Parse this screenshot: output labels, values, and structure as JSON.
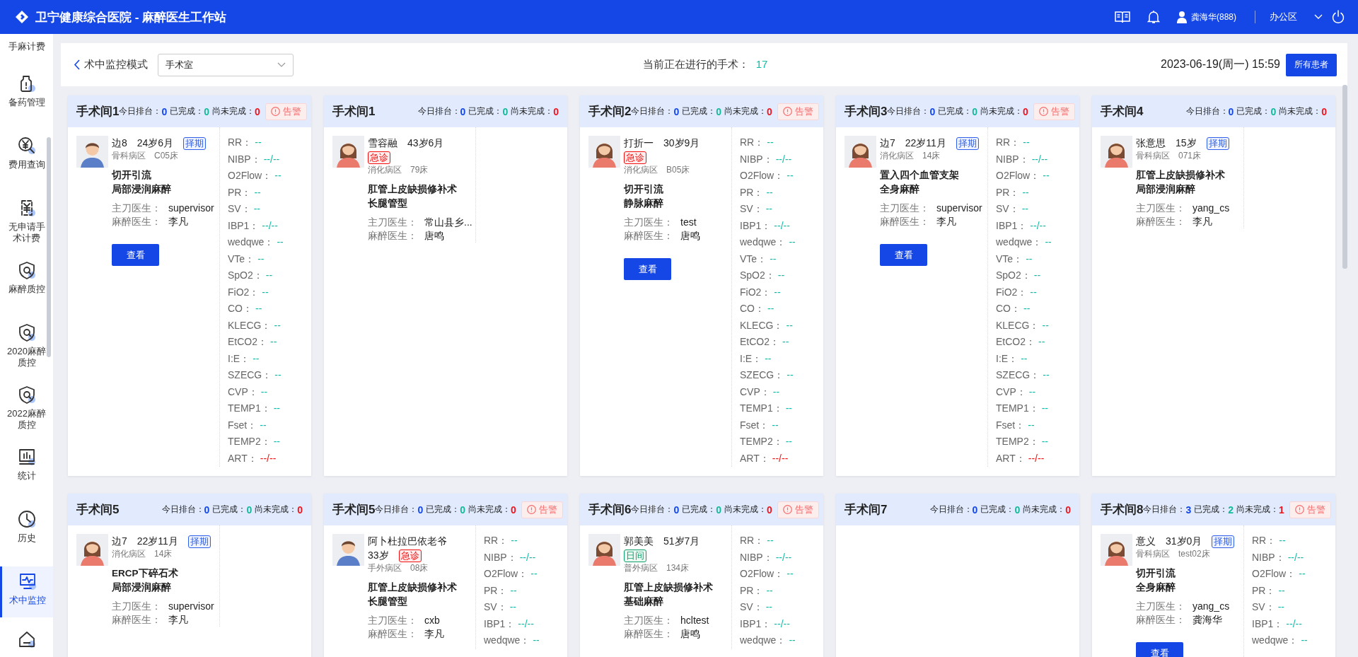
{
  "header": {
    "title": "卫宁健康综合医院 - 麻醉医生工作站",
    "user": "龚海华(888)",
    "area": "办公区"
  },
  "sidebar": {
    "items": [
      {
        "label": "手麻计费",
        "selected": false
      },
      {
        "label": "备药管理",
        "selected": false
      },
      {
        "label": "费用查询",
        "selected": false
      },
      {
        "label": "无申请手术计费",
        "selected": false
      },
      {
        "label": "麻醉质控",
        "selected": false
      },
      {
        "label": "2020麻醉质控",
        "selected": false
      },
      {
        "label": "2022麻醉质控",
        "selected": false
      },
      {
        "label": "统计",
        "selected": false
      },
      {
        "label": "历史",
        "selected": false
      },
      {
        "label": "术中监控",
        "selected": true
      }
    ]
  },
  "toolbar": {
    "back_label": "术中监控模式",
    "room_select": {
      "value": "手术室"
    },
    "running_label": "当前正在进行的手术：",
    "running_count": "17",
    "datetime": "2023-06-19(周一) 15:59",
    "all_patients_button": "所有患者"
  },
  "rooms": [
    {
      "name": "手术间1",
      "alarm": "告警",
      "stats": [
        {
          "label": "今日排台：",
          "value": "0",
          "kind": "scheduled"
        },
        {
          "label": "已完成：",
          "value": "0",
          "kind": "done"
        },
        {
          "label": "尚未完成：",
          "value": "0",
          "kind": "pending"
        }
      ],
      "patient": {
        "avatar": {
          "kind": "male"
        },
        "name": "边8",
        "age": "24岁6月",
        "tag": {
          "label": "择期",
          "kind": "elective"
        },
        "ward": "骨科病区",
        "bed": "C05床",
        "procedure": "切开引流",
        "anesthesia": "局部浸润麻醉",
        "surgeon_label": "主刀医生：",
        "surgeon": "supervisor",
        "anesthetist_label": "麻醉医生：",
        "anesthetist": "李凡",
        "view_button": "查看"
      },
      "vitals": [
        {
          "parameter": "RR：",
          "reading": "--",
          "abnormal": false
        },
        {
          "parameter": "NIBP：",
          "reading": "--/--",
          "abnormal": false
        },
        {
          "parameter": "O2Flow：",
          "reading": "--",
          "abnormal": false
        },
        {
          "parameter": "PR：",
          "reading": "--",
          "abnormal": false
        },
        {
          "parameter": "SV：",
          "reading": "--",
          "abnormal": false
        },
        {
          "parameter": "IBP1：",
          "reading": "--/--",
          "abnormal": false
        },
        {
          "parameter": "wedqwe：",
          "reading": "--",
          "abnormal": false
        },
        {
          "parameter": "VTe：",
          "reading": "--",
          "abnormal": false
        },
        {
          "parameter": "SpO2：",
          "reading": "--",
          "abnormal": false
        },
        {
          "parameter": "FiO2：",
          "reading": "--",
          "abnormal": false
        },
        {
          "parameter": "CO：",
          "reading": "--",
          "abnormal": false
        },
        {
          "parameter": "KLECG：",
          "reading": "--",
          "abnormal": false
        },
        {
          "parameter": "EtCO2：",
          "reading": "--",
          "abnormal": false
        },
        {
          "parameter": "I:E：",
          "reading": "--",
          "abnormal": false
        },
        {
          "parameter": "SZECG：",
          "reading": "--",
          "abnormal": false
        },
        {
          "parameter": "CVP：",
          "reading": "--",
          "abnormal": false
        },
        {
          "parameter": "TEMP1：",
          "reading": "--",
          "abnormal": false
        },
        {
          "parameter": "Fset：",
          "reading": "--",
          "abnormal": false
        },
        {
          "parameter": "TEMP2：",
          "reading": "--",
          "abnormal": false
        },
        {
          "parameter": "ART：",
          "reading": "--/--",
          "abnormal": true
        }
      ]
    },
    {
      "name": "手术间1",
      "stats": [
        {
          "label": "今日排台：",
          "value": "0",
          "kind": "scheduled"
        },
        {
          "label": "已完成：",
          "value": "0",
          "kind": "done"
        },
        {
          "label": "尚未完成：",
          "value": "0",
          "kind": "pending"
        }
      ],
      "patient": {
        "avatar": {
          "kind": "female"
        },
        "name": "雪容融",
        "age": "43岁6月",
        "tag": {
          "label": "急诊",
          "kind": "emergency"
        },
        "ward": "消化病区",
        "bed": "79床",
        "procedure": "肛管上皮缺损修补术",
        "anesthesia": "长腿管型",
        "surgeon_label": "主刀医生：",
        "surgeon": "常山县乡...",
        "anesthetist_label": "麻醉医生：",
        "anesthetist": "唐鸣"
      }
    },
    {
      "name": "手术间2",
      "alarm": "告警",
      "stats": [
        {
          "label": "今日排台：",
          "value": "0",
          "kind": "scheduled"
        },
        {
          "label": "已完成：",
          "value": "0",
          "kind": "done"
        },
        {
          "label": "尚未完成：",
          "value": "0",
          "kind": "pending"
        }
      ],
      "patient": {
        "avatar": {
          "kind": "female"
        },
        "name": "打折一",
        "age": "30岁9月",
        "tag": {
          "label": "急诊",
          "kind": "emergency"
        },
        "ward": "消化病区",
        "bed": "B05床",
        "procedure": "切开引流",
        "anesthesia": "静脉麻醉",
        "surgeon_label": "主刀医生：",
        "surgeon": "test",
        "anesthetist_label": "麻醉医生：",
        "anesthetist": "唐鸣",
        "view_button": "查看"
      },
      "vitals": [
        {
          "parameter": "RR：",
          "reading": "--",
          "abnormal": false
        },
        {
          "parameter": "NIBP：",
          "reading": "--/--",
          "abnormal": false
        },
        {
          "parameter": "O2Flow：",
          "reading": "--",
          "abnormal": false
        },
        {
          "parameter": "PR：",
          "reading": "--",
          "abnormal": false
        },
        {
          "parameter": "SV：",
          "reading": "--",
          "abnormal": false
        },
        {
          "parameter": "IBP1：",
          "reading": "--/--",
          "abnormal": false
        },
        {
          "parameter": "wedqwe：",
          "reading": "--",
          "abnormal": false
        },
        {
          "parameter": "VTe：",
          "reading": "--",
          "abnormal": false
        },
        {
          "parameter": "SpO2：",
          "reading": "--",
          "abnormal": false
        },
        {
          "parameter": "FiO2：",
          "reading": "--",
          "abnormal": false
        },
        {
          "parameter": "CO：",
          "reading": "--",
          "abnormal": false
        },
        {
          "parameter": "KLECG：",
          "reading": "--",
          "abnormal": false
        },
        {
          "parameter": "EtCO2：",
          "reading": "--",
          "abnormal": false
        },
        {
          "parameter": "I:E：",
          "reading": "--",
          "abnormal": false
        },
        {
          "parameter": "SZECG：",
          "reading": "--",
          "abnormal": false
        },
        {
          "parameter": "CVP：",
          "reading": "--",
          "abnormal": false
        },
        {
          "parameter": "TEMP1：",
          "reading": "--",
          "abnormal": false
        },
        {
          "parameter": "Fset：",
          "reading": "--",
          "abnormal": false
        },
        {
          "parameter": "TEMP2：",
          "reading": "--",
          "abnormal": false
        },
        {
          "parameter": "ART：",
          "reading": "--/--",
          "abnormal": true
        }
      ]
    },
    {
      "name": "手术间3",
      "alarm": "告警",
      "stats": [
        {
          "label": "今日排台：",
          "value": "0",
          "kind": "scheduled"
        },
        {
          "label": "已完成：",
          "value": "0",
          "kind": "done"
        },
        {
          "label": "尚未完成：",
          "value": "0",
          "kind": "pending"
        }
      ],
      "patient": {
        "avatar": {
          "kind": "female"
        },
        "name": "边7",
        "age": "22岁11月",
        "tag": {
          "label": "择期",
          "kind": "elective"
        },
        "ward": "消化病区",
        "bed": "14床",
        "procedure": "置入四个血管支架",
        "anesthesia": "全身麻醉",
        "surgeon_label": "主刀医生：",
        "surgeon": "supervisor",
        "anesthetist_label": "麻醉医生：",
        "anesthetist": "李凡",
        "view_button": "查看"
      },
      "vitals": [
        {
          "parameter": "RR：",
          "reading": "--",
          "abnormal": false
        },
        {
          "parameter": "NIBP：",
          "reading": "--/--",
          "abnormal": false
        },
        {
          "parameter": "O2Flow：",
          "reading": "--",
          "abnormal": false
        },
        {
          "parameter": "PR：",
          "reading": "--",
          "abnormal": false
        },
        {
          "parameter": "SV：",
          "reading": "--",
          "abnormal": false
        },
        {
          "parameter": "IBP1：",
          "reading": "--/--",
          "abnormal": false
        },
        {
          "parameter": "wedqwe：",
          "reading": "--",
          "abnormal": false
        },
        {
          "parameter": "VTe：",
          "reading": "--",
          "abnormal": false
        },
        {
          "parameter": "SpO2：",
          "reading": "--",
          "abnormal": false
        },
        {
          "parameter": "FiO2：",
          "reading": "--",
          "abnormal": false
        },
        {
          "parameter": "CO：",
          "reading": "--",
          "abnormal": false
        },
        {
          "parameter": "KLECG：",
          "reading": "--",
          "abnormal": false
        },
        {
          "parameter": "EtCO2：",
          "reading": "--",
          "abnormal": false
        },
        {
          "parameter": "I:E：",
          "reading": "--",
          "abnormal": false
        },
        {
          "parameter": "SZECG：",
          "reading": "--",
          "abnormal": false
        },
        {
          "parameter": "CVP：",
          "reading": "--",
          "abnormal": false
        },
        {
          "parameter": "TEMP1：",
          "reading": "--",
          "abnormal": false
        },
        {
          "parameter": "Fset：",
          "reading": "--",
          "abnormal": false
        },
        {
          "parameter": "TEMP2：",
          "reading": "--",
          "abnormal": false
        },
        {
          "parameter": "ART：",
          "reading": "--/--",
          "abnormal": true
        }
      ]
    },
    {
      "name": "手术间4",
      "stats": [
        {
          "label": "今日排台：",
          "value": "0",
          "kind": "scheduled"
        },
        {
          "label": "已完成：",
          "value": "0",
          "kind": "done"
        },
        {
          "label": "尚未完成：",
          "value": "0",
          "kind": "pending"
        }
      ],
      "patient": {
        "avatar": {
          "kind": "female"
        },
        "name": "张意思",
        "age": "15岁",
        "tag": {
          "label": "择期",
          "kind": "elective"
        },
        "ward": "骨科病区",
        "bed": "071床",
        "procedure": "肛管上皮缺损修补术",
        "anesthesia": "局部浸润麻醉",
        "surgeon_label": "主刀医生：",
        "surgeon": "yang_cs",
        "anesthetist_label": "麻醉医生：",
        "anesthetist": "李凡"
      }
    },
    {
      "name": "手术间5",
      "stats": [
        {
          "label": "今日排台：",
          "value": "0",
          "kind": "scheduled"
        },
        {
          "label": "已完成：",
          "value": "0",
          "kind": "done"
        },
        {
          "label": "尚未完成：",
          "value": "0",
          "kind": "pending"
        }
      ],
      "patient": {
        "avatar": {
          "kind": "female"
        },
        "name": "边7",
        "age": "22岁11月",
        "tag": {
          "label": "择期",
          "kind": "elective"
        },
        "ward": "消化病区",
        "bed": "14床",
        "procedure": "ERCP下碎石术",
        "anesthesia": "局部浸润麻醉",
        "surgeon_label": "主刀医生：",
        "surgeon": "supervisor",
        "anesthetist_label": "麻醉医生：",
        "anesthetist": "李凡"
      }
    },
    {
      "name": "手术间5",
      "alarm": "告警",
      "stats": [
        {
          "label": "今日排台：",
          "value": "0",
          "kind": "scheduled"
        },
        {
          "label": "已完成：",
          "value": "0",
          "kind": "done"
        },
        {
          "label": "尚未完成：",
          "value": "0",
          "kind": "pending"
        }
      ],
      "patient": {
        "avatar": {
          "kind": "male"
        },
        "name": "阿卜杜拉巴依老爷",
        "age": "33岁",
        "tag": {
          "label": "急诊",
          "kind": "emergency"
        },
        "ward": "手外病区",
        "bed": "08床",
        "procedure": "肛管上皮缺损修补术",
        "anesthesia": "长腿管型",
        "surgeon_label": "主刀医生：",
        "surgeon": "cxb",
        "anesthetist_label": "麻醉医生：",
        "anesthetist": "李凡"
      },
      "vitals": [
        {
          "parameter": "RR：",
          "reading": "--",
          "abnormal": false
        },
        {
          "parameter": "NIBP：",
          "reading": "--/--",
          "abnormal": false
        },
        {
          "parameter": "O2Flow：",
          "reading": "--",
          "abnormal": false
        },
        {
          "parameter": "PR：",
          "reading": "--",
          "abnormal": false
        },
        {
          "parameter": "SV：",
          "reading": "--",
          "abnormal": false
        },
        {
          "parameter": "IBP1：",
          "reading": "--/--",
          "abnormal": false
        },
        {
          "parameter": "wedqwe：",
          "reading": "--",
          "abnormal": false
        }
      ]
    },
    {
      "name": "手术间6",
      "alarm": "告警",
      "stats": [
        {
          "label": "今日排台：",
          "value": "0",
          "kind": "scheduled"
        },
        {
          "label": "已完成：",
          "value": "0",
          "kind": "done"
        },
        {
          "label": "尚未完成：",
          "value": "0",
          "kind": "pending"
        }
      ],
      "patient": {
        "avatar": {
          "kind": "female"
        },
        "name": "郭美美",
        "age": "51岁7月",
        "tag": {
          "label": "日间",
          "kind": "day"
        },
        "ward": "普外病区",
        "bed": "134床",
        "procedure": "肛管上皮缺损修补术",
        "anesthesia": "基础麻醉",
        "surgeon_label": "主刀医生：",
        "surgeon": "hcltest",
        "anesthetist_label": "麻醉医生：",
        "anesthetist": "唐鸣"
      },
      "vitals": [
        {
          "parameter": "RR：",
          "reading": "--",
          "abnormal": false
        },
        {
          "parameter": "NIBP：",
          "reading": "--/--",
          "abnormal": false
        },
        {
          "parameter": "O2Flow：",
          "reading": "--",
          "abnormal": false
        },
        {
          "parameter": "PR：",
          "reading": "--",
          "abnormal": false
        },
        {
          "parameter": "SV：",
          "reading": "--",
          "abnormal": false
        },
        {
          "parameter": "IBP1：",
          "reading": "--/--",
          "abnormal": false
        },
        {
          "parameter": "wedqwe：",
          "reading": "--",
          "abnormal": false
        }
      ]
    },
    {
      "name": "手术间7",
      "stats": [
        {
          "label": "今日排台：",
          "value": "0",
          "kind": "scheduled"
        },
        {
          "label": "已完成：",
          "value": "0",
          "kind": "done"
        },
        {
          "label": "尚未完成：",
          "value": "0",
          "kind": "pending"
        }
      ]
    },
    {
      "name": "手术间8",
      "alarm": "告警",
      "stats": [
        {
          "label": "今日排台：",
          "value": "3",
          "kind": "scheduled"
        },
        {
          "label": "已完成：",
          "value": "2",
          "kind": "done"
        },
        {
          "label": "尚未完成：",
          "value": "1",
          "kind": "pending"
        }
      ],
      "patient": {
        "avatar": {
          "kind": "female"
        },
        "name": "意义",
        "age": "31岁0月",
        "tag": {
          "label": "择期",
          "kind": "elective"
        },
        "ward": "骨科病区",
        "bed": "test02床",
        "procedure": "切开引流",
        "anesthesia": "全身麻醉",
        "surgeon_label": "主刀医生：",
        "surgeon": "yang_cs",
        "anesthetist_label": "麻醉医生：",
        "anesthetist": "龚海华",
        "view_button": "查看"
      },
      "vitals": [
        {
          "parameter": "RR：",
          "reading": "--",
          "abnormal": false
        },
        {
          "parameter": "NIBP：",
          "reading": "--/--",
          "abnormal": false
        },
        {
          "parameter": "O2Flow：",
          "reading": "--",
          "abnormal": false
        },
        {
          "parameter": "PR：",
          "reading": "--",
          "abnormal": false
        },
        {
          "parameter": "SV：",
          "reading": "--",
          "abnormal": false
        },
        {
          "parameter": "IBP1：",
          "reading": "--/--",
          "abnormal": false
        },
        {
          "parameter": "wedqwe：",
          "reading": "--",
          "abnormal": false
        }
      ]
    }
  ]
}
